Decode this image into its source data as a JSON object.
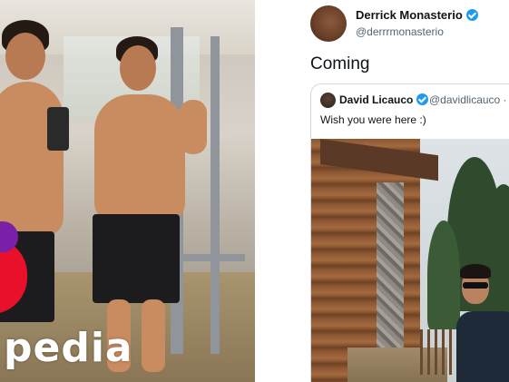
{
  "left_photo": {
    "watermark_text": "pedia"
  },
  "tweet": {
    "author": {
      "name": "Derrick Monasterio",
      "handle": "@derrrmonasterio",
      "verified_color": "#1d9bf0"
    },
    "text": "Coming",
    "quoted_tweet": {
      "author_name": "David Licauco",
      "author_handle": "@davidlicauco ·",
      "text": "Wish you were here :)"
    }
  },
  "colors": {
    "text_primary": "#0f1419",
    "text_secondary": "#536471",
    "border": "#cfd9de",
    "watermark_red": "#e8102a",
    "watermark_purple": "#7a1fa8"
  }
}
